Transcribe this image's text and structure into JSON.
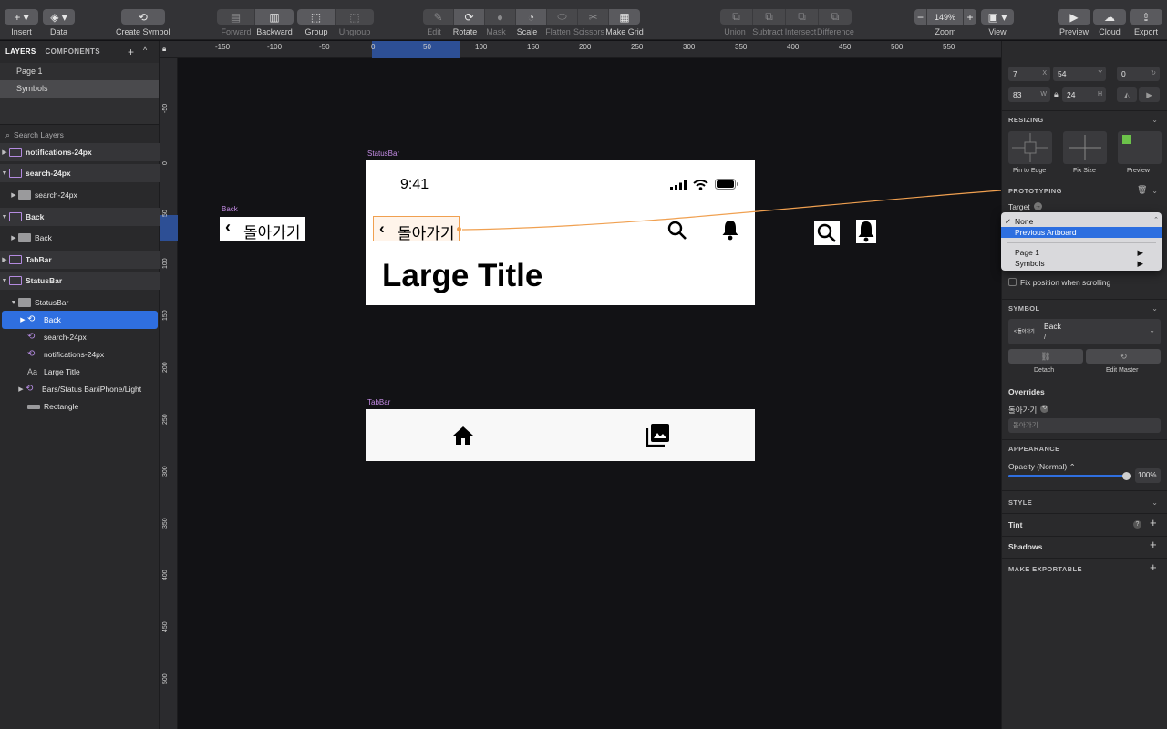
{
  "toolbar": {
    "insert": "Insert",
    "data": "Data",
    "create_symbol": "Create Symbol",
    "forward": "Forward",
    "backward": "Backward",
    "group": "Group",
    "ungroup": "Ungroup",
    "edit": "Edit",
    "rotate": "Rotate",
    "mask": "Mask",
    "scale": "Scale",
    "flatten": "Flatten",
    "scissors": "Scissors",
    "make_grid": "Make Grid",
    "union": "Union",
    "subtract": "Subtract",
    "intersect": "Intersect",
    "difference": "Difference",
    "zoom_label": "Zoom",
    "zoom_value": "149%",
    "view": "View",
    "preview": "Preview",
    "cloud": "Cloud",
    "export": "Export"
  },
  "left_panel": {
    "tab_layers": "LAYERS",
    "tab_components": "COMPONENTS",
    "pages": [
      "Page 1",
      "Symbols"
    ],
    "search_placeholder": "Search Layers",
    "layers": [
      {
        "name": "notifications-24px",
        "kind": "artboard",
        "level": 0
      },
      {
        "name": "search-24px",
        "kind": "artboard",
        "level": 0
      },
      {
        "name": "search-24px",
        "kind": "folder",
        "level": 1
      },
      {
        "name": "Back",
        "kind": "artboard",
        "level": 0
      },
      {
        "name": "Back",
        "kind": "folder",
        "level": 1
      },
      {
        "name": "TabBar",
        "kind": "artboard",
        "level": 0
      },
      {
        "name": "StatusBar",
        "kind": "artboard",
        "level": 0
      },
      {
        "name": "StatusBar",
        "kind": "folder",
        "level": 1
      },
      {
        "name": "Back",
        "kind": "symbol",
        "level": 2,
        "selected": true
      },
      {
        "name": "search-24px",
        "kind": "symbol",
        "level": 2
      },
      {
        "name": "notifications-24px",
        "kind": "symbol",
        "level": 2
      },
      {
        "name": "Large Title",
        "kind": "text",
        "level": 2
      },
      {
        "name": "Bars/Status Bar/iPhone/Light",
        "kind": "symbol-group",
        "level": 2
      },
      {
        "name": "Rectangle",
        "kind": "rect",
        "level": 2
      }
    ]
  },
  "rulers": {
    "top": [
      "-150",
      "-100",
      "-50",
      "0",
      "50",
      "100",
      "150",
      "200",
      "250",
      "300",
      "350",
      "400",
      "450",
      "500",
      "550"
    ],
    "left": [
      "-50",
      "0",
      "50",
      "100",
      "150",
      "200",
      "250",
      "300",
      "350",
      "400",
      "450",
      "500"
    ]
  },
  "canvas": {
    "statusbar_label": "StatusBar",
    "time": "9:41",
    "back_text": "돌아가기",
    "large_title": "Large Title",
    "back_board_label": "Back",
    "tabbar_label": "TabBar"
  },
  "right_panel": {
    "x": "7",
    "y": "54",
    "rot": "0",
    "w": "83",
    "h": "24",
    "x_unit": "X",
    "y_unit": "Y",
    "w_unit": "W",
    "h_unit": "H",
    "resizing": "RESIZING",
    "pin_to_edge": "Pin to Edge",
    "fix_size": "Fix Size",
    "preview": "Preview",
    "prototyping": "PROTOTYPING",
    "target": "Target",
    "fix_position": "Fix position when scrolling",
    "symbol": "SYMBOL",
    "symbol_name": "Back",
    "symbol_path": "/",
    "symbol_thumb": "< 돌아가기",
    "detach": "Detach",
    "edit_master": "Edit Master",
    "overrides": "Overrides",
    "override_label": "돌아가기",
    "override_value": "돌아가기",
    "appearance": "APPEARANCE",
    "opacity_label": "Opacity (Normal)",
    "opacity_value": "100%",
    "opacity": 1.0,
    "style": "STYLE",
    "tint": "Tint",
    "shadows": "Shadows",
    "make_exportable": "MAKE EXPORTABLE"
  },
  "dropdown": {
    "none": "None",
    "previous_artboard": "Previous Artboard",
    "page1": "Page 1",
    "symbols": "Symbols"
  },
  "colors": {
    "accent": "#2f6fe0",
    "artboard_label": "#c58ce6",
    "hotspot": "#f0a050"
  }
}
